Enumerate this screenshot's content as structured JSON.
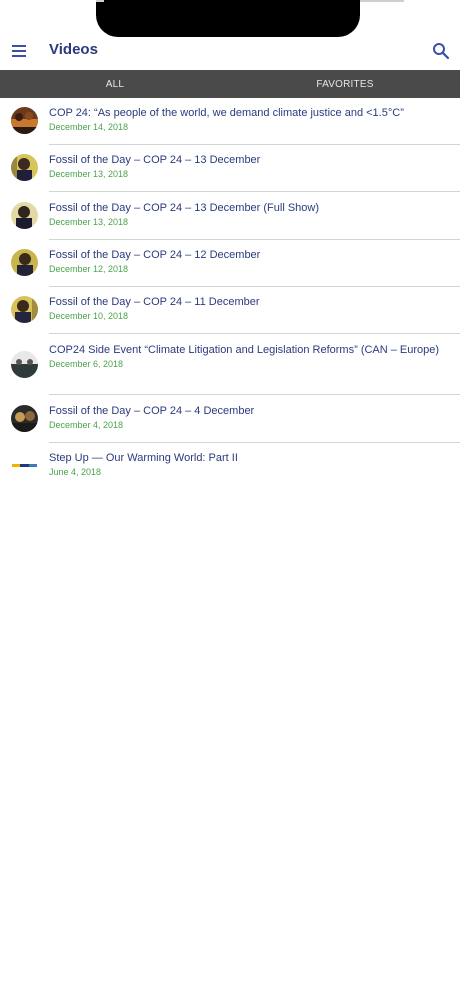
{
  "app": {
    "title": "Videos"
  },
  "tabs": [
    {
      "label": "ALL"
    },
    {
      "label": "FAVORITES"
    }
  ],
  "videos": [
    {
      "title": "COP 24: “As people of the world, we demand climate justice and <1.5°C”",
      "date": "December 14, 2018",
      "thumb": "crowd"
    },
    {
      "title": "Fossil of the Day – COP 24 – 13 December",
      "date": "December 13, 2018",
      "thumb": "speaker"
    },
    {
      "title": "Fossil of the Day – COP 24 – 13 December (Full Show)",
      "date": "December 13, 2018",
      "thumb": "speaker"
    },
    {
      "title": "Fossil of the Day – COP 24 – 12 December",
      "date": "December 12, 2018",
      "thumb": "speaker"
    },
    {
      "title": "Fossil of the Day – COP 24 – 11 December",
      "date": "December 10, 2018",
      "thumb": "speaker"
    },
    {
      "title": "COP24 Side Event “Climate Litigation and Legislation Reforms” (CAN – Europe)",
      "date": "December 6, 2018",
      "thumb": "panel"
    },
    {
      "title": "Fossil of the Day – COP 24 – 4 December",
      "date": "December 4, 2018",
      "thumb": "speaker"
    },
    {
      "title": "Step Up — Our Warming World: Part II",
      "date": "June 4, 2018",
      "thumb": "logo"
    }
  ]
}
